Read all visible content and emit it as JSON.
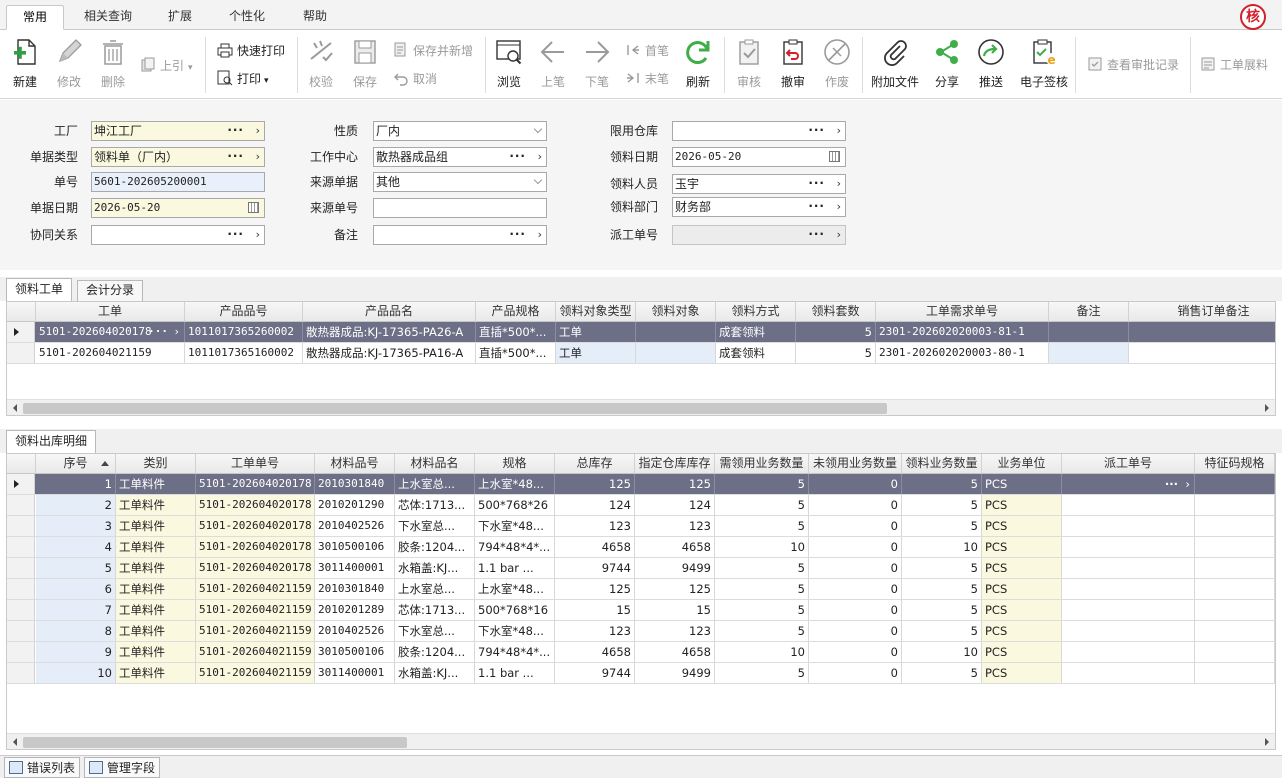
{
  "menu": {
    "tabs": [
      "常用",
      "相关查询",
      "扩展",
      "个性化",
      "帮助"
    ],
    "badge": "核"
  },
  "toolbar": {
    "new": "新建",
    "edit": "修改",
    "delete": "删除",
    "prev_ref": "上引",
    "quick_print": "快速打印",
    "print": "打印",
    "verify": "校验",
    "save": "保存",
    "save_new": "保存并新增",
    "cancel": "取消",
    "browse": "浏览",
    "prev": "上笔",
    "next": "下笔",
    "first": "首笔",
    "last": "末笔",
    "refresh": "刷新",
    "audit": "审核",
    "unaudit": "撤审",
    "void": "作废",
    "attach": "附加文件",
    "share": "分享",
    "push": "推送",
    "esign": "电子签核",
    "audit_log": "查看审批记录",
    "work_material": "工单展料"
  },
  "form": {
    "factory_label": "工厂",
    "factory": "坤江工厂",
    "doctype_label": "单据类型",
    "doctype": "领料单（厂内）",
    "docno_label": "单号",
    "docno": "5601-202605200001",
    "docdate_label": "单据日期",
    "docdate": "2026-05-20",
    "collab_label": "协同关系",
    "collab": "",
    "nature_label": "性质",
    "nature": "厂内",
    "workcenter_label": "工作中心",
    "workcenter": "散热器成品组",
    "srcdoc_label": "来源单据",
    "srcdoc": "其他",
    "srcno_label": "来源单号",
    "srcno": "",
    "remark_label": "备注",
    "remark": "",
    "warehouse_label": "限用仓库",
    "warehouse": "",
    "pickdate_label": "领料日期",
    "pickdate": "2026-05-20",
    "picker_label": "领料人员",
    "picker": "玉宇",
    "dept_label": "领料部门",
    "dept": "财务部",
    "dispatch_label": "派工单号",
    "dispatch": ""
  },
  "upper_tabs": [
    "领料工单",
    "会计分录"
  ],
  "upper_grid": {
    "headers": [
      "工单",
      "产品品号",
      "产品品名",
      "产品规格",
      "领料对象类型",
      "领料对象",
      "领料方式",
      "领料套数",
      "工单需求单号",
      "备注",
      "销售订单备注"
    ],
    "rows": [
      [
        "5101-202604020178",
        "1011017365260002",
        "散热器成品:KJ-17365-PA26-A",
        "直插*500*...",
        "工单",
        "",
        "成套领料",
        "5",
        "2301-202602020003-81-1",
        "",
        ""
      ],
      [
        "5101-202604021159",
        "1011017365160002",
        "散热器成品:KJ-17365-PA16-A",
        "直插*500*...",
        "工单",
        "",
        "成套领料",
        "5",
        "2301-202602020003-80-1",
        "",
        ""
      ]
    ]
  },
  "lower_tabs": [
    "领料出库明细"
  ],
  "lower_grid": {
    "headers": [
      "序号",
      "类别",
      "工单单号",
      "材料品号",
      "材料品名",
      "规格",
      "总库存",
      "指定仓库库存",
      "需领用业务数量",
      "未领用业务数量",
      "领料业务数量",
      "业务单位",
      "派工单号",
      "特征码规格"
    ],
    "rows": [
      [
        "1",
        "工单料件",
        "5101-202604020178",
        "2010301840",
        "上水室总...",
        "上水室*48...",
        "125",
        "125",
        "5",
        "0",
        "5",
        "PCS",
        "",
        ""
      ],
      [
        "2",
        "工单料件",
        "5101-202604020178",
        "2010201290",
        "芯体:1713...",
        "500*768*26",
        "124",
        "124",
        "5",
        "0",
        "5",
        "PCS",
        "",
        ""
      ],
      [
        "3",
        "工单料件",
        "5101-202604020178",
        "2010402526",
        "下水室总...",
        "下水室*48...",
        "123",
        "123",
        "5",
        "0",
        "5",
        "PCS",
        "",
        ""
      ],
      [
        "4",
        "工单料件",
        "5101-202604020178",
        "3010500106",
        "胶条:1204...",
        "794*48*4*...",
        "4658",
        "4658",
        "10",
        "0",
        "10",
        "PCS",
        "",
        ""
      ],
      [
        "5",
        "工单料件",
        "5101-202604020178",
        "3011400001",
        "水箱盖:KJ...",
        "1.1 bar  ...",
        "9744",
        "9499",
        "5",
        "0",
        "5",
        "PCS",
        "",
        ""
      ],
      [
        "6",
        "工单料件",
        "5101-202604021159",
        "2010301840",
        "上水室总...",
        "上水室*48...",
        "125",
        "125",
        "5",
        "0",
        "5",
        "PCS",
        "",
        ""
      ],
      [
        "7",
        "工单料件",
        "5101-202604021159",
        "2010201289",
        "芯体:1713...",
        "500*768*16",
        "15",
        "15",
        "5",
        "0",
        "5",
        "PCS",
        "",
        ""
      ],
      [
        "8",
        "工单料件",
        "5101-202604021159",
        "2010402526",
        "下水室总...",
        "下水室*48...",
        "123",
        "123",
        "5",
        "0",
        "5",
        "PCS",
        "",
        ""
      ],
      [
        "9",
        "工单料件",
        "5101-202604021159",
        "3010500106",
        "胶条:1204...",
        "794*48*4*...",
        "4658",
        "4658",
        "10",
        "0",
        "10",
        "PCS",
        "",
        ""
      ],
      [
        "10",
        "工单料件",
        "5101-202604021159",
        "3011400001",
        "水箱盖:KJ...",
        "1.1 bar  ...",
        "9744",
        "9499",
        "5",
        "0",
        "5",
        "PCS",
        "",
        ""
      ]
    ]
  },
  "status_tabs": [
    "错误列表",
    "管理字段"
  ],
  "colors": {
    "selected_row": "#6c6f85",
    "required_field": "#fbf8e0",
    "key_field": "#e5eef8",
    "accent_green": "#3fae49",
    "badge_red": "#d2202a"
  }
}
